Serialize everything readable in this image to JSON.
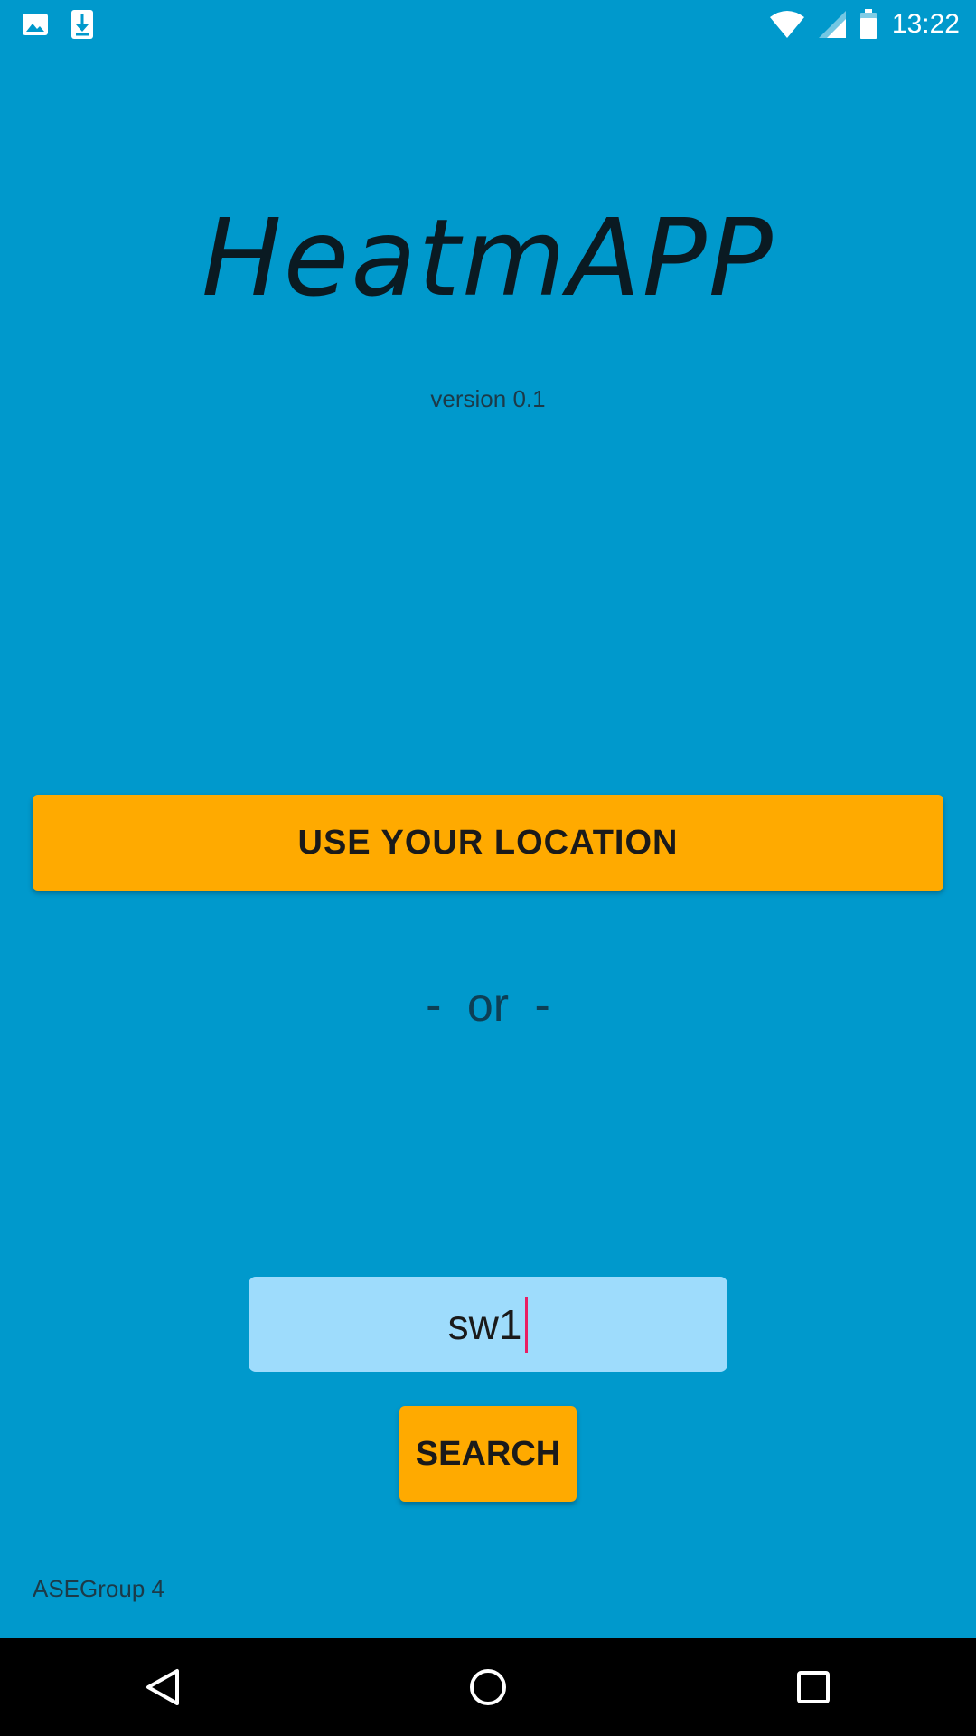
{
  "status_bar": {
    "time": "13:22",
    "left_icons": [
      "image-icon",
      "download-icon"
    ],
    "right_icons": [
      "wifi-icon",
      "signal-icon",
      "battery-icon"
    ]
  },
  "app": {
    "title": "HeatmAPP",
    "version": "version 0.1"
  },
  "location": {
    "button_label": "USE YOUR LOCATION"
  },
  "separator": {
    "text": "-  or  -"
  },
  "search": {
    "value": "sw1",
    "button_label": "SEARCH"
  },
  "footer": {
    "credit": "ASEGroup 4"
  },
  "nav_bar": {
    "buttons": [
      "back-icon",
      "home-icon",
      "recents-icon"
    ]
  },
  "colors": {
    "background": "#0099cc",
    "accent": "#ffaa00",
    "input_background": "#9edcfc",
    "cursor": "#e91e63"
  }
}
